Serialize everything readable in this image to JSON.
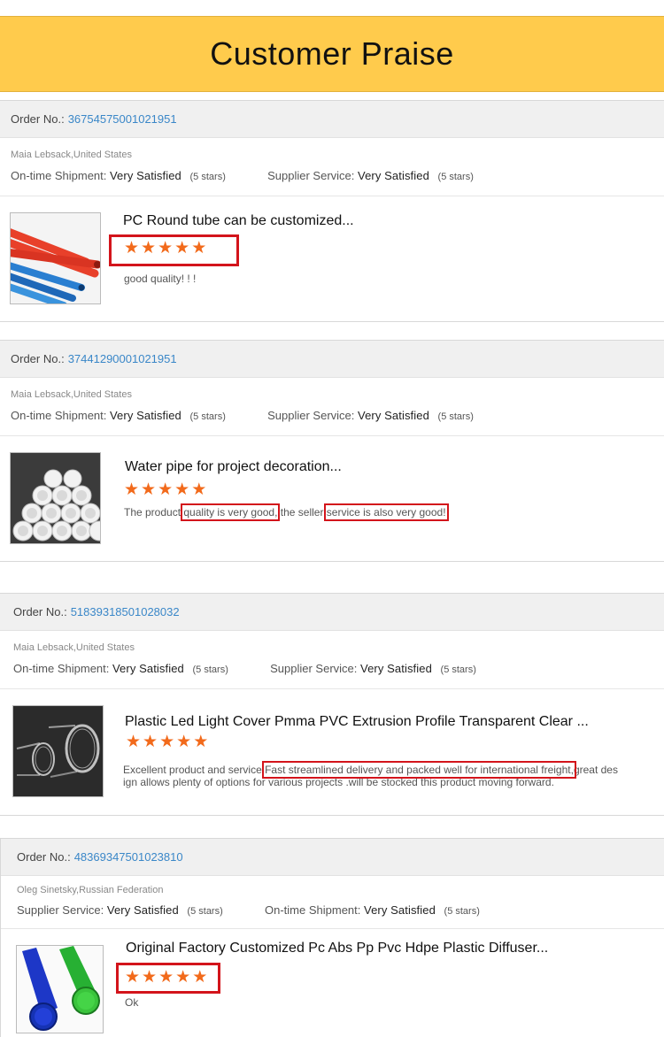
{
  "header": {
    "title": "Customer Praise"
  },
  "labels": {
    "order_no": "Order No.:",
    "ontime": "On-time Shipment:",
    "supplier": "Supplier Service:",
    "star_icon": "star-icon"
  },
  "reviews": [
    {
      "order_no": "36754575001021951",
      "buyer": "Maia Lebsack,United States",
      "rating1_value": "Very Satisfied",
      "rating1_stars": "(5 stars)",
      "rating2_value": "Very Satisfied",
      "rating2_stars": "(5 stars)",
      "product_title": "PC Round tube can be customized...",
      "product_stars": 5,
      "comment": "good quality! ! !"
    },
    {
      "order_no": "37441290001021951",
      "buyer": "Maia Lebsack,United States",
      "rating1_value": "Very Satisfied",
      "rating1_stars": "(5 stars)",
      "rating2_value": "Very Satisfied",
      "rating2_stars": "(5 stars)",
      "product_title": "Water pipe for project decoration...",
      "product_stars": 5,
      "comment_parts": [
        "The product ",
        "quality is very good,",
        " the seller ",
        "service is also very good!"
      ]
    },
    {
      "order_no": "51839318501028032",
      "buyer": "Maia Lebsack,United States",
      "rating1_value": "Very Satisfied",
      "rating1_stars": "(5 stars)",
      "rating2_value": "Very Satisfied",
      "rating2_stars": "(5 stars)",
      "product_title": "Plastic Led Light Cover Pmma PVC Extrusion Profile Transparent Clear ...",
      "product_stars": 5,
      "comment_parts": [
        "Excellent product and service ",
        "Fast streamlined delivery and packed well for international freight,",
        "great des"
      ],
      "comment_line2": "ign allows plenty of options for various projects .will be stocked this product  moving forward."
    },
    {
      "order_no": "48369347501023810",
      "buyer": "Oleg Sinetsky,Russian Federation",
      "rating1_label": "Supplier Service:",
      "rating1_value": "Very Satisfied",
      "rating1_stars": "(5 stars)",
      "rating2_label": "On-time Shipment:",
      "rating2_value": "Very Satisfied",
      "rating2_stars": "(5 stars)",
      "product_title": "Original Factory Customized Pc Abs Pp Pvc Hdpe Plastic Diffuser...",
      "product_stars": 5,
      "comment": "Ok"
    }
  ]
}
